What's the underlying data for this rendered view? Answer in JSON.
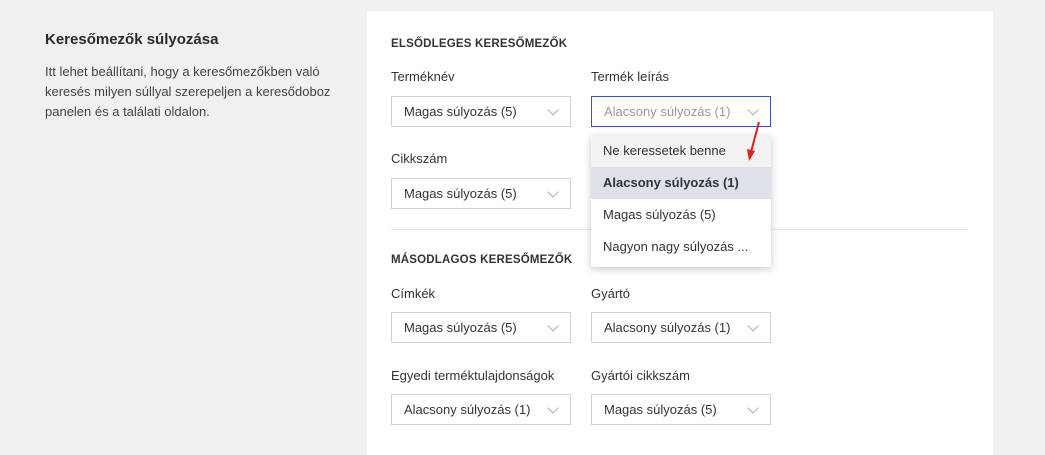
{
  "left": {
    "title": "Keresőmezők súlyozása",
    "description": "Itt lehet beállítani, hogy a keresőmezőkben való keresés milyen súllyal szerepeljen a keresődoboz panelen és a találati oldalon."
  },
  "primary": {
    "title": "ELSŐDLEGES KERESŐMEZŐK",
    "fields": [
      {
        "label": "Terméknév",
        "value": "Magas súlyozás (5)"
      },
      {
        "label": "Termék leírás",
        "value": "Alacsony súlyozás (1)"
      },
      {
        "label": "Cikkszám",
        "value": "Magas súlyozás (5)"
      }
    ]
  },
  "secondary": {
    "title": "MÁSODLAGOS KERESŐMEZŐK",
    "fields": [
      {
        "label": "Címkék",
        "value": "Magas súlyozás (5)"
      },
      {
        "label": "Gyártó",
        "value": "Alacsony súlyozás (1)"
      },
      {
        "label": "Egyedi terméktulajdonságok",
        "value": "Alacsony súlyozás (1)"
      },
      {
        "label": "Gyártói cikkszám",
        "value": "Magas súlyozás (5)"
      }
    ]
  },
  "dropdown": {
    "options": [
      "Ne keressetek benne",
      "Alacsony súlyozás (1)",
      "Magas súlyozás (5)",
      "Nagyon nagy súlyozás ..."
    ],
    "selected": "Alacsony súlyozás (1)"
  },
  "colors": {
    "annotation_arrow": "#e0201c",
    "focus_border": "#3a55b5",
    "selected_bg": "#dde1e9"
  }
}
